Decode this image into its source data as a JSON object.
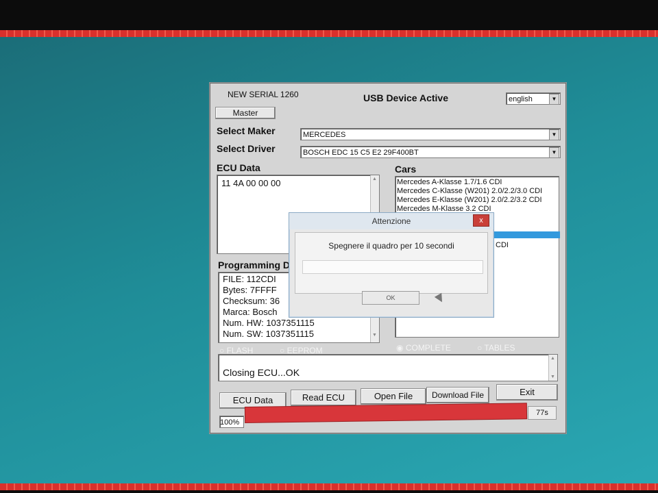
{
  "app": {
    "serial": "NEW SERIAL 1260",
    "device_status": "USB Device Active",
    "language": "english",
    "master_button": "Master",
    "select_maker_label": "Select Maker",
    "select_maker_value": "MERCEDES",
    "select_driver_label": "Select Driver",
    "select_driver_value": "BOSCH EDC 15 C5  E2 29F400BT",
    "ecu_data_label": "ECU Data",
    "ecu_data_value": "11 4A 00 00 00",
    "cars_label": "Cars",
    "cars": [
      "Mercedes A-Klasse 1.7/1.6 CDI",
      "Mercedes C-Klasse (W201) 2.0/2.2/3.0 CDI",
      "Mercedes E-Klasse (W201) 2.0/2.2/3.2 CDI",
      "Mercedes M-Klasse 3.2 CDI"
    ],
    "cars_partial": "CDI",
    "programming_label": "Programming D",
    "programming_lines": [
      "FILE: 112CDI",
      "Bytes: 7FFFF",
      "Checksum: 36",
      "Marca: Bosch",
      "Num. HW: 1037351115",
      "Num. SW: 1037351115"
    ],
    "radio_flash": "FLASH",
    "radio_eeprom": "EEPROM",
    "radio_complete": "COMPLETE",
    "radio_tables": "TABLES",
    "status_text": "Closing ECU...OK",
    "buttons": {
      "ecu_data": "ECU Data",
      "read_ecu": "Read ECU",
      "open_file": "Open File",
      "download_file": "Download File",
      "exit": "Exit"
    },
    "progress_percent": "100%",
    "progress_value": 1.0,
    "progress_time": "77s"
  },
  "dialog": {
    "title": "Attenzione",
    "close": "x",
    "message": "Spegnere il quadro per 10 secondi",
    "ok": "OK"
  },
  "colors": {
    "window_bg": "#d5d5d5",
    "desktop": "#1f8d98",
    "progress": "#d8363a",
    "selection": "#3399dd",
    "close_button": "#c9403a"
  }
}
